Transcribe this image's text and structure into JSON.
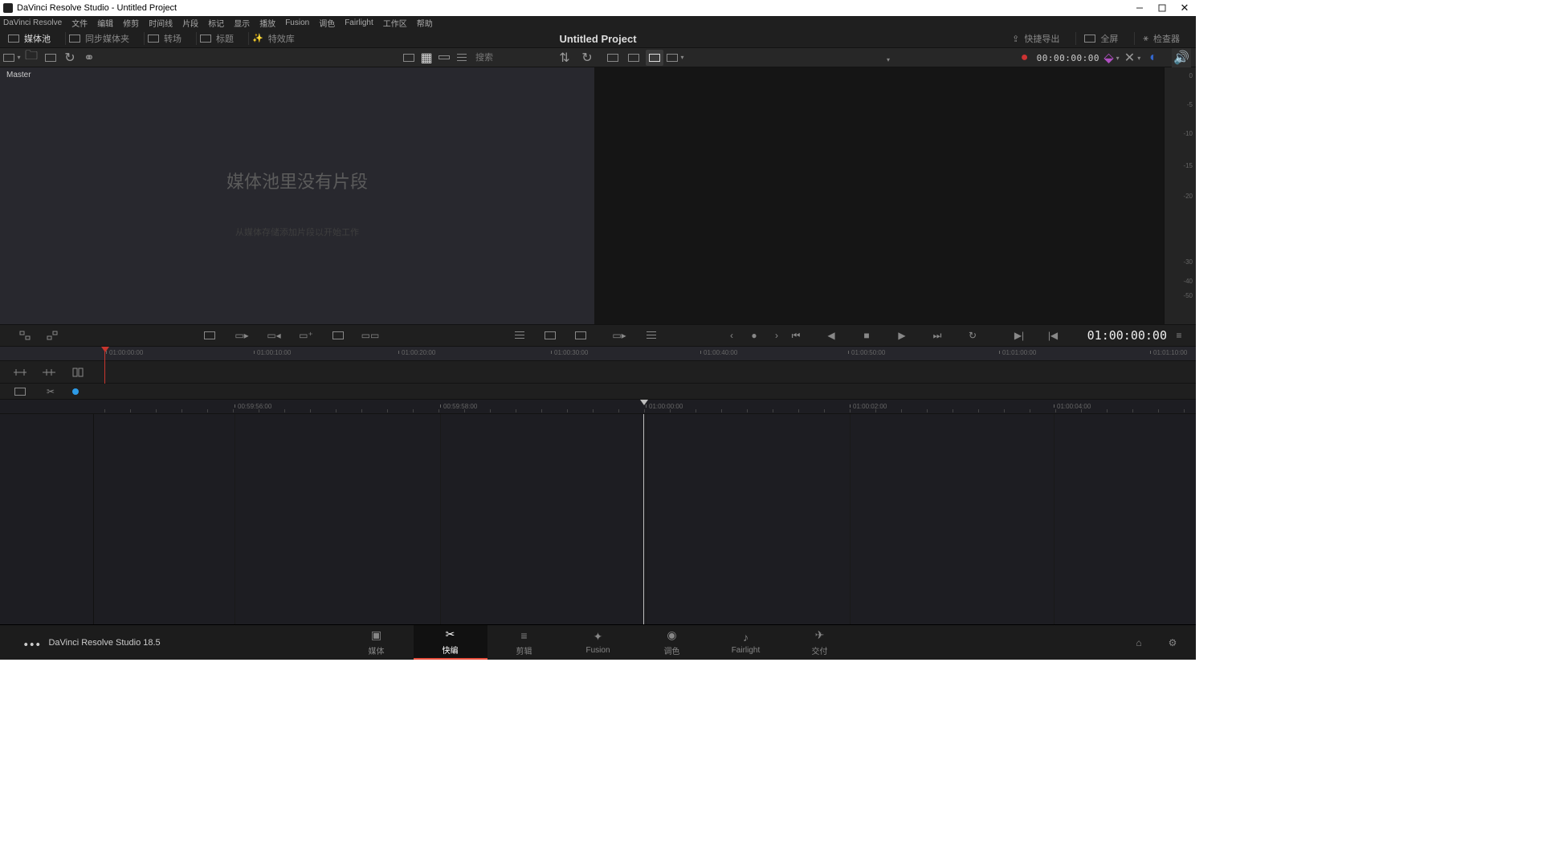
{
  "window": {
    "title": "DaVinci Resolve Studio - Untitled Project"
  },
  "menu": [
    "DaVinci Resolve",
    "文件",
    "编辑",
    "修剪",
    "时间线",
    "片段",
    "标记",
    "显示",
    "播放",
    "Fusion",
    "调色",
    "Fairlight",
    "工作区",
    "帮助"
  ],
  "workspace_tabs": {
    "left": [
      {
        "label": "媒体池",
        "icon": "mediapool"
      },
      {
        "label": "同步媒体夹",
        "icon": "sync"
      },
      {
        "label": "转场",
        "icon": "transition"
      },
      {
        "label": "标题",
        "icon": "title"
      },
      {
        "label": "特效库",
        "icon": "effects"
      }
    ],
    "right": [
      {
        "label": "快捷导出",
        "icon": "export"
      },
      {
        "label": "全屏",
        "icon": "fullscreen"
      },
      {
        "label": "检查器",
        "icon": "inspector"
      }
    ]
  },
  "project_title": "Untitled Project",
  "search_placeholder": "搜索",
  "viewer_tc": "00:00:00:00",
  "mediapool": {
    "breadcrumb": "Master",
    "empty_heading": "媒体池里没有片段",
    "empty_sub": "从媒体存储添加片段以开始工作"
  },
  "meter_db": [
    "0",
    "-5",
    "-10",
    "-15",
    "-20",
    "-30",
    "-40",
    "-50"
  ],
  "transport_tc": "01:00:00:00",
  "ruler_upper": [
    {
      "pos": 136,
      "label": "01:00:00:00"
    },
    {
      "pos": 320,
      "label": "01:00:10:00"
    },
    {
      "pos": 500,
      "label": "01:00:20:00"
    },
    {
      "pos": 690,
      "label": "01:00:30:00"
    },
    {
      "pos": 876,
      "label": "01:00:40:00"
    },
    {
      "pos": 1060,
      "label": "01:00:50:00"
    },
    {
      "pos": 1248,
      "label": "01:01:00:00"
    },
    {
      "pos": 1436,
      "label": "01:01:10:00"
    }
  ],
  "ruler_lower": [
    {
      "pos": 296,
      "label": "00:59:56:00"
    },
    {
      "pos": 552,
      "label": "00:59:58:00"
    },
    {
      "pos": 808,
      "label": "01:00:00:00"
    },
    {
      "pos": 1062,
      "label": "01:00:02:00"
    },
    {
      "pos": 1316,
      "label": "01:00:04:00"
    }
  ],
  "pages": [
    {
      "label": "媒体",
      "id": "media"
    },
    {
      "label": "快编",
      "id": "cut",
      "active": true
    },
    {
      "label": "剪辑",
      "id": "edit"
    },
    {
      "label": "Fusion",
      "id": "fusion"
    },
    {
      "label": "调色",
      "id": "color"
    },
    {
      "label": "Fairlight",
      "id": "fairlight"
    },
    {
      "label": "交付",
      "id": "deliver"
    }
  ],
  "brand": "DaVinci Resolve Studio 18.5"
}
